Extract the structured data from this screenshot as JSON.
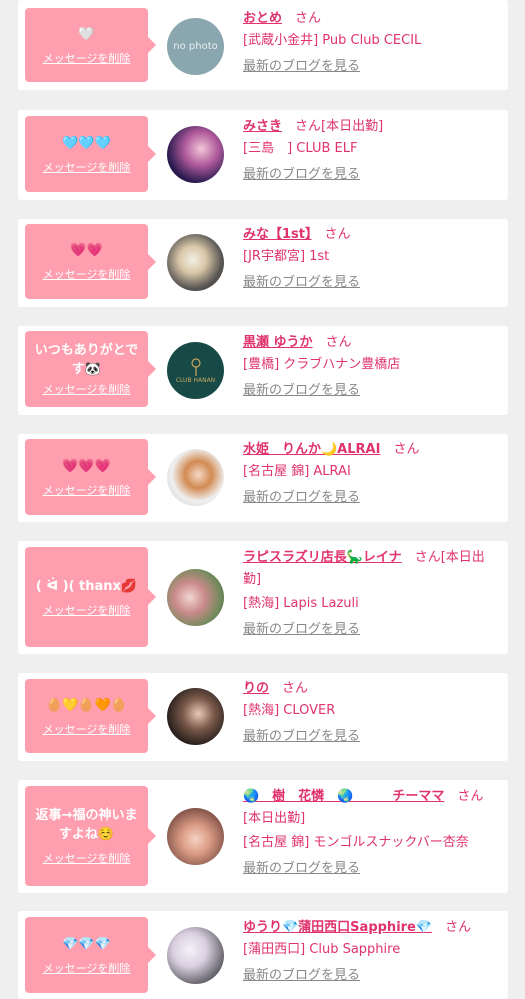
{
  "delete_label": "メッセージを削除",
  "blog_label": "最新のブログを見る",
  "san": "さん",
  "items": [
    {
      "message": "🤍",
      "name": "おとめ",
      "status": "",
      "shop": "[武蔵小金井] Pub Club CECIL",
      "avatar_text": "no photo"
    },
    {
      "message": "🩵🩵🩵",
      "name": "みさき",
      "status": "[本日出勤]",
      "shop": "[三島　] CLUB ELF",
      "avatar_text": ""
    },
    {
      "message": "💗💗",
      "name": "みな【1st】",
      "status": "",
      "shop": "[JR宇都宮] 1st",
      "avatar_text": ""
    },
    {
      "message": "いつもありがとです🐼",
      "name": "黒瀬 ゆうか",
      "status": "",
      "shop": "[豊橋] クラブハナン豊橋店",
      "avatar_text": "CLUB HANAN"
    },
    {
      "message": "💗💗💗",
      "name": "水姫　りんか🌙ALRAI",
      "status": "",
      "shop": "[名古屋 錦] ALRAI",
      "avatar_text": ""
    },
    {
      "message": "( ᐛ )( thanx💋",
      "name": "ラピスラズリ店長🦕レイナ",
      "status": "[本日出勤]",
      "shop": "[熱海] Lapis Lazuli",
      "avatar_text": ""
    },
    {
      "message": "🥚💛🥚🧡🥚",
      "name": "りの",
      "status": "",
      "shop": "[熱海] CLOVER",
      "avatar_text": ""
    },
    {
      "message": "返事→福の神いますよね☺️",
      "name": "🌏　樹　花憐　🌏　　　チーママ",
      "status": "[本日出勤]",
      "shop": "[名古屋 錦] モンゴルスナックバー杏奈",
      "avatar_text": ""
    },
    {
      "message": "💎💎💎",
      "name": "ゆうり💎蒲田西口Sapphire💎",
      "status": "",
      "shop": "[蒲田西口] Club Sapphire",
      "avatar_text": ""
    }
  ],
  "colors": {
    "accent": "#e0336b",
    "bubble": "#ff9eae",
    "background": "#efefef"
  }
}
